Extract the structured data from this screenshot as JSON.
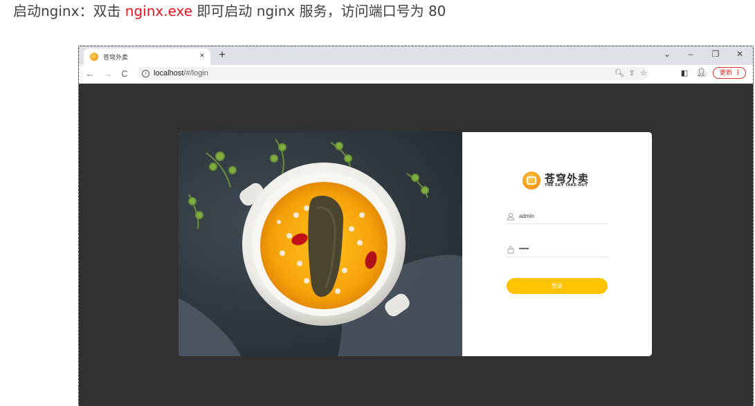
{
  "doc": {
    "before": "启动nginx：双击 ",
    "highlight": "nginx.exe",
    "after": " 即可启动 nginx 服务，访问端口号为 80",
    "highlight_color": "#e8141f"
  },
  "browser": {
    "tab": {
      "title": "苍穹外卖",
      "close": "×"
    },
    "new_tab": "+",
    "window_controls": {
      "minimize": "–",
      "restore": "❐",
      "close": "✕",
      "tab_search": "⌄"
    },
    "nav": {
      "back": "←",
      "forward": "→",
      "reload": "C"
    },
    "omnibox": {
      "host": "localhost",
      "path": "/#/login",
      "info": "i"
    },
    "update_label": "更新",
    "menu_dots": "⋮"
  },
  "login": {
    "brand": {
      "name": "苍穹外卖",
      "subtitle": "THE SKY TAKE-OUT",
      "accent": "#ffc200"
    },
    "username": {
      "value": "admin"
    },
    "password": {
      "value": "••••••"
    },
    "submit_label": "登录"
  }
}
